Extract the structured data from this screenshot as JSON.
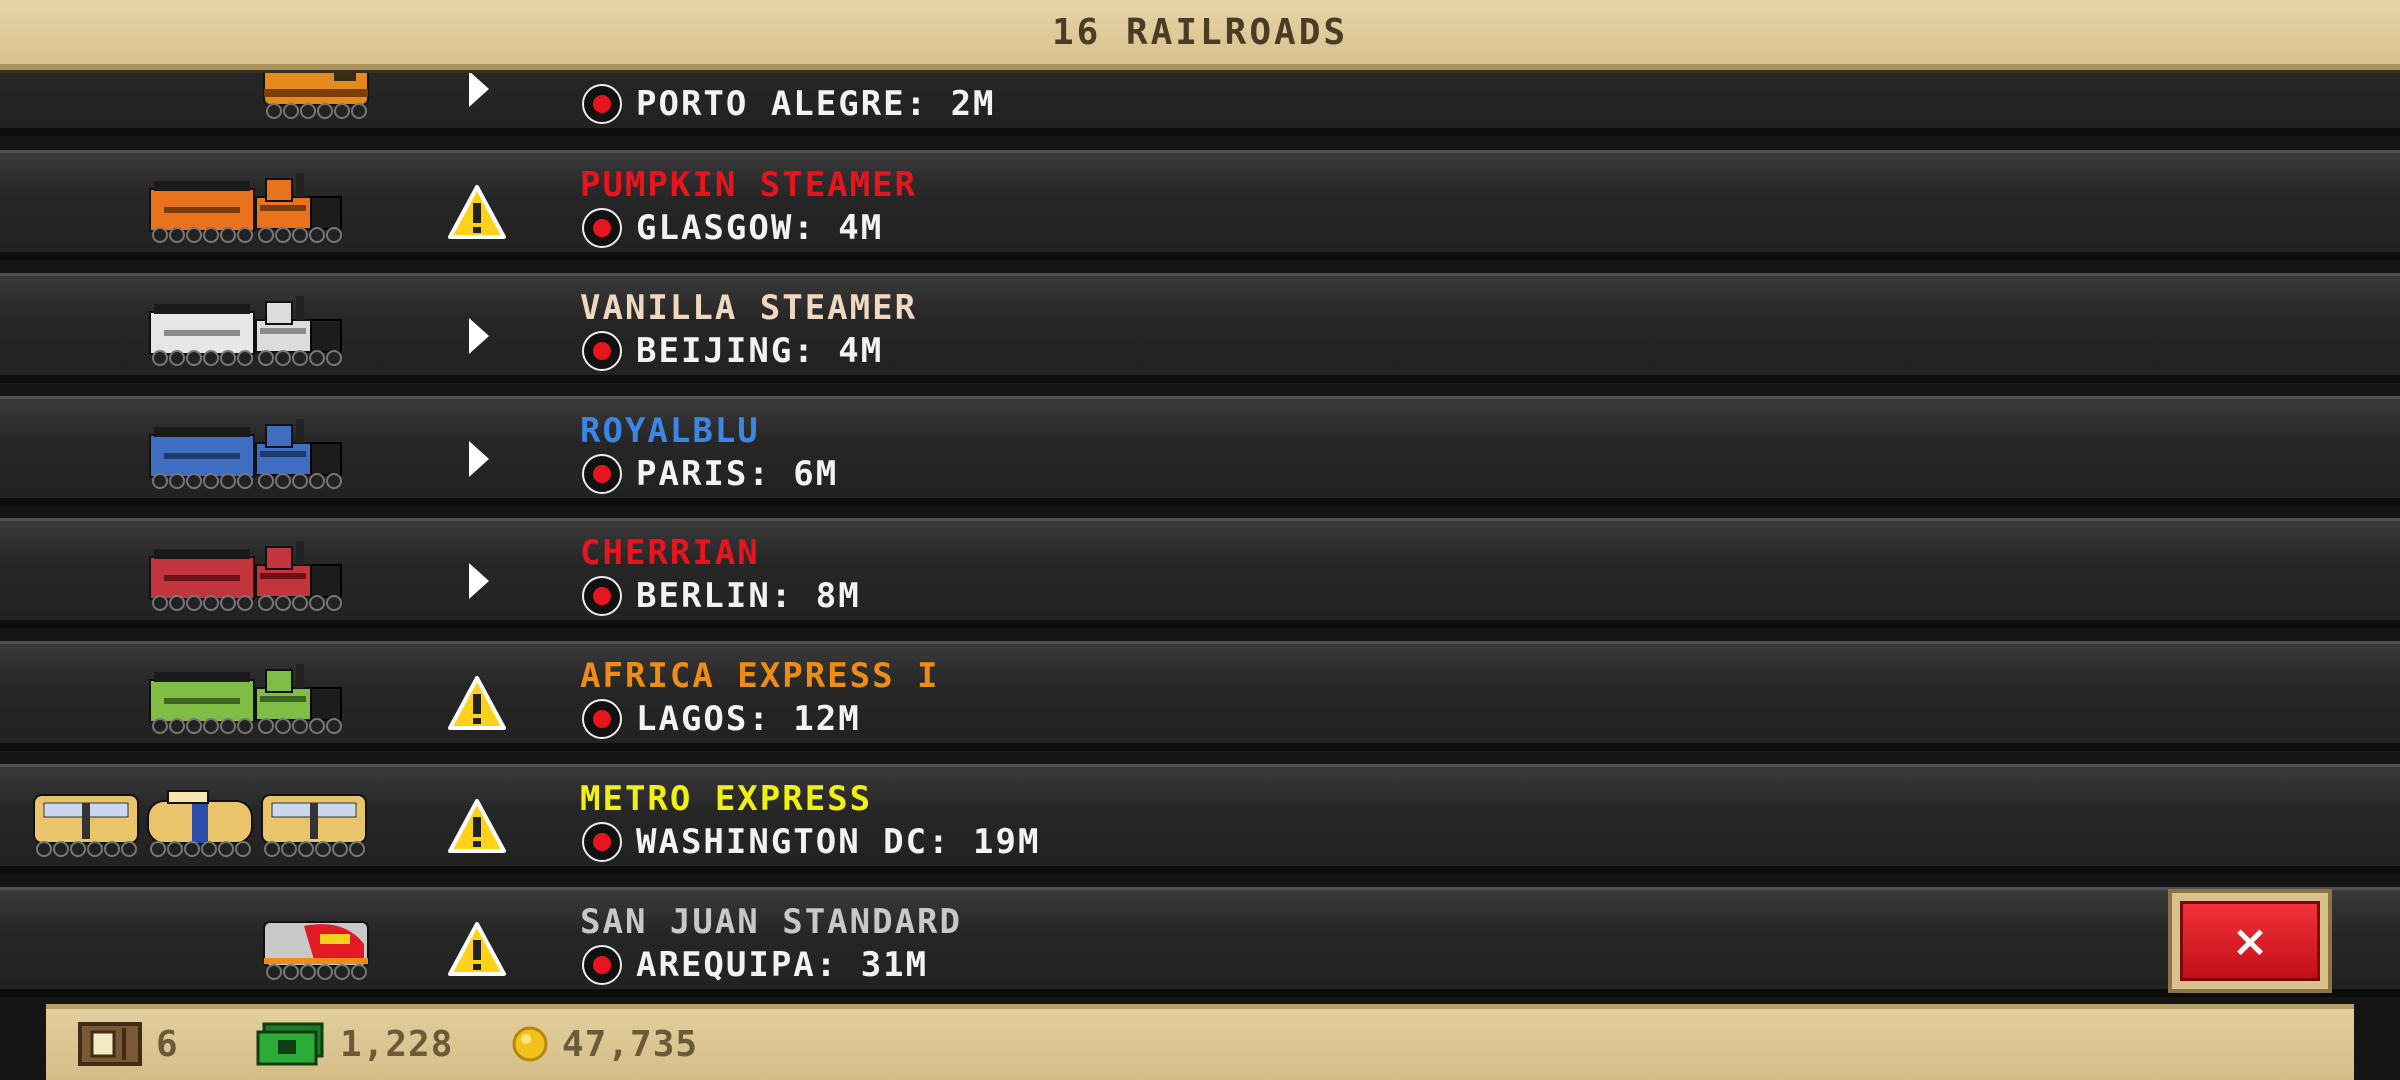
{
  "header": {
    "title": "16 RAILROADS"
  },
  "trains": [
    {
      "name": "",
      "destination": "PORTO ALEGRE: 2M",
      "status": "play",
      "name_color": "#ffffff",
      "train_style": "diesel-orange"
    },
    {
      "name": "PUMPKIN STEAMER",
      "destination": "GLASGOW: 4M",
      "status": "warning",
      "name_color": "#e8141e",
      "train_style": "steam-orange"
    },
    {
      "name": "VANILLA STEAMER",
      "destination": "BEIJING: 4M",
      "status": "play",
      "name_color": "#f0d7bf",
      "train_style": "steam-white"
    },
    {
      "name": "ROYALBLU",
      "destination": "PARIS: 6M",
      "status": "play",
      "name_color": "#3c86e6",
      "train_style": "steam-blue"
    },
    {
      "name": "CHERRIAN",
      "destination": "BERLIN: 8M",
      "status": "play",
      "name_color": "#e8141e",
      "train_style": "steam-red"
    },
    {
      "name": "AFRICA EXPRESS I",
      "destination": "LAGOS: 12M",
      "status": "warning",
      "name_color": "#f08c14",
      "train_style": "steam-green"
    },
    {
      "name": "METRO EXPRESS",
      "destination": "WASHINGTON DC: 19M",
      "status": "warning",
      "name_color": "#f0f014",
      "train_style": "metro"
    },
    {
      "name": "SAN JUAN STANDARD",
      "destination": "AREQUIPA: 31M",
      "status": "warning",
      "name_color": "#c8c8c8",
      "train_style": "diesel-red"
    }
  ],
  "close_button": {
    "label": "×"
  },
  "footer": {
    "stat1_value": "6",
    "cash_value": "1,228",
    "coins_value": "47,735"
  }
}
